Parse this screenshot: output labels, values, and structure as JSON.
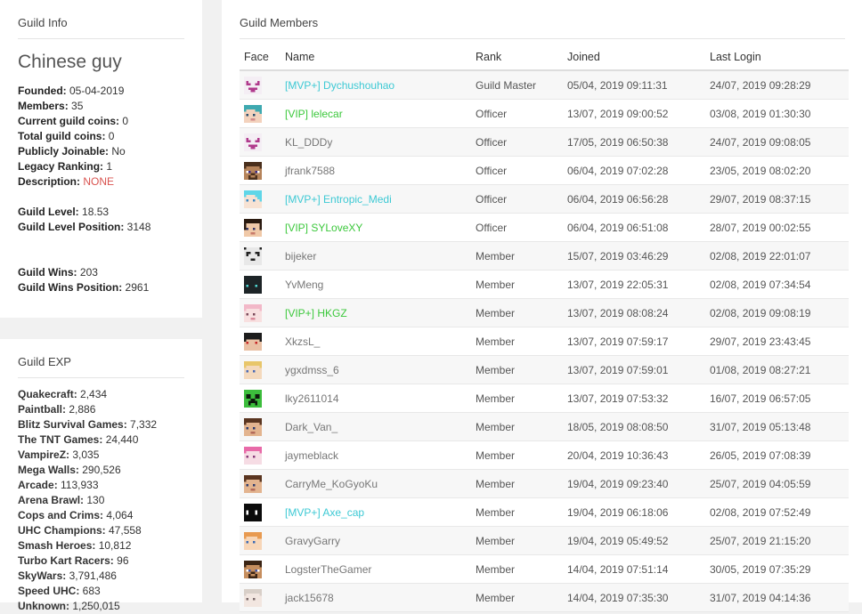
{
  "info": {
    "title": "Guild Info",
    "name": "Chinese guy",
    "stats": [
      {
        "label": "Founded:",
        "value": " 05-04-2019"
      },
      {
        "label": "Members:",
        "value": " 35"
      },
      {
        "label": "Current guild coins:",
        "value": " 0"
      },
      {
        "label": "Total guild coins:",
        "value": " 0"
      },
      {
        "label": "Publicly Joinable:",
        "value": " No"
      },
      {
        "label": "Legacy Ranking:",
        "value": " 1"
      },
      {
        "label": "Description:",
        "value": " NONE"
      }
    ],
    "level": {
      "label": "Guild Level:",
      "value": " 18.53"
    },
    "level_pos": {
      "label": "Guild Level Position:",
      "value": " 3148"
    },
    "wins": {
      "label": "Guild Wins:",
      "value": " 203"
    },
    "wins_pos": {
      "label": "Guild Wins Position:",
      "value": " 2961"
    },
    "none_color": "#d9534f"
  },
  "exp": {
    "title": "Guild EXP",
    "rows": [
      {
        "label": "Quakecraft:",
        "value": " 2,434"
      },
      {
        "label": "Paintball:",
        "value": " 2,886"
      },
      {
        "label": "Blitz Survival Games:",
        "value": " 7,332"
      },
      {
        "label": "The TNT Games:",
        "value": " 24,440"
      },
      {
        "label": "VampireZ:",
        "value": " 3,035"
      },
      {
        "label": "Mega Walls:",
        "value": " 290,526"
      },
      {
        "label": "Arcade:",
        "value": " 113,933"
      },
      {
        "label": "Arena Brawl:",
        "value": " 130"
      },
      {
        "label": "Cops and Crims:",
        "value": " 4,064"
      },
      {
        "label": "UHC Champions:",
        "value": " 47,558"
      },
      {
        "label": "Smash Heroes:",
        "value": " 10,812"
      },
      {
        "label": "Turbo Kart Racers:",
        "value": " 96"
      },
      {
        "label": "SkyWars:",
        "value": " 3,791,486"
      },
      {
        "label": "Speed UHC:",
        "value": " 683"
      },
      {
        "label": "Unknown:",
        "value": " 1,250,015"
      }
    ]
  },
  "members": {
    "title": "Guild Members",
    "columns": [
      "Face",
      "Name",
      "Rank",
      "Joined",
      "Last Login"
    ],
    "colors": {
      "mvp": "#3dc9d4",
      "vip": "#3cc83c",
      "plain": "#777777"
    },
    "rows": [
      {
        "face": "pink-skull-skin",
        "rank_tag": "[MVP+]",
        "name": "Dychushouhao",
        "style": "mvp",
        "rank": "Guild Master",
        "joined": "05/04, 2019 09:11:31",
        "last": "24/07, 2019 09:28:29"
      },
      {
        "face": "teal-hair-skin",
        "rank_tag": "[VIP]",
        "name": "lelecar",
        "style": "vip",
        "rank": "Officer",
        "joined": "13/07, 2019 09:00:52",
        "last": "03/08, 2019 01:30:30"
      },
      {
        "face": "pink-skull-skin",
        "rank_tag": "",
        "name": "KL_DDDy",
        "style": "plain",
        "rank": "Officer",
        "joined": "17/05, 2019 06:50:38",
        "last": "24/07, 2019 09:08:05"
      },
      {
        "face": "brown-skin",
        "rank_tag": "",
        "name": "jfrank7588",
        "style": "plain",
        "rank": "Officer",
        "joined": "06/04, 2019 07:02:28",
        "last": "23/05, 2019 08:02:20"
      },
      {
        "face": "cyan-hair-skin",
        "rank_tag": "[MVP+]",
        "name": "Entropic_Medi",
        "style": "mvp",
        "rank": "Officer",
        "joined": "06/04, 2019 06:56:28",
        "last": "29/07, 2019 08:37:15"
      },
      {
        "face": "dark-hair-skin",
        "rank_tag": "[VIP]",
        "name": "SYLoveXY",
        "style": "vip",
        "rank": "Officer",
        "joined": "06/04, 2019 06:51:08",
        "last": "28/07, 2019 00:02:55"
      },
      {
        "face": "panda-skin",
        "rank_tag": "",
        "name": "bijeker",
        "style": "plain",
        "rank": "Member",
        "joined": "15/07, 2019 03:46:29",
        "last": "02/08, 2019 22:01:07"
      },
      {
        "face": "black-mask-skin",
        "rank_tag": "",
        "name": "YvMeng",
        "style": "plain",
        "rank": "Member",
        "joined": "13/07, 2019 22:05:31",
        "last": "02/08, 2019 07:34:54"
      },
      {
        "face": "light-pink-skin",
        "rank_tag": "[VIP+]",
        "name": "HKGZ",
        "style": "vip",
        "rank": "Member",
        "joined": "13/07, 2019 08:08:24",
        "last": "02/08, 2019 09:08:19"
      },
      {
        "face": "red-eyes-skin",
        "rank_tag": "",
        "name": "XkzsL_",
        "style": "plain",
        "rank": "Member",
        "joined": "13/07, 2019 07:59:17",
        "last": "29/07, 2019 23:43:45"
      },
      {
        "face": "blonde-skin",
        "rank_tag": "",
        "name": "ygxdmss_6",
        "style": "plain",
        "rank": "Member",
        "joined": "13/07, 2019 07:59:01",
        "last": "01/08, 2019 08:27:21"
      },
      {
        "face": "creeper-skin",
        "rank_tag": "",
        "name": "lky2611014",
        "style": "plain",
        "rank": "Member",
        "joined": "13/07, 2019 07:53:32",
        "last": "16/07, 2019 06:57:05"
      },
      {
        "face": "brown-hair-skin",
        "rank_tag": "",
        "name": "Dark_Van_",
        "style": "plain",
        "rank": "Member",
        "joined": "18/05, 2019 08:08:50",
        "last": "31/07, 2019 05:13:48"
      },
      {
        "face": "pink-hair-skin",
        "rank_tag": "",
        "name": "jaymeblack",
        "style": "plain",
        "rank": "Member",
        "joined": "20/04, 2019 10:36:43",
        "last": "26/05, 2019 07:08:39"
      },
      {
        "face": "brown-hair-skin",
        "rank_tag": "",
        "name": "CarryMe_KoGyoKu",
        "style": "plain",
        "rank": "Member",
        "joined": "19/04, 2019 09:23:40",
        "last": "25/07, 2019 04:05:59"
      },
      {
        "face": "black-face-skin",
        "rank_tag": "[MVP+]",
        "name": "Axe_cap",
        "style": "mvp",
        "rank": "Member",
        "joined": "19/04, 2019 06:18:06",
        "last": "02/08, 2019 07:52:49"
      },
      {
        "face": "orange-hair-skin",
        "rank_tag": "",
        "name": "GravyGarry",
        "style": "plain",
        "rank": "Member",
        "joined": "19/04, 2019 05:49:52",
        "last": "25/07, 2019 21:15:20"
      },
      {
        "face": "steve-skin",
        "rank_tag": "",
        "name": "LogsterTheGamer",
        "style": "plain",
        "rank": "Member",
        "joined": "14/04, 2019 07:51:14",
        "last": "30/05, 2019 07:35:29"
      },
      {
        "face": "pale-skin",
        "rank_tag": "",
        "name": "jack15678",
        "style": "plain",
        "rank": "Member",
        "joined": "14/04, 2019 07:35:30",
        "last": "31/07, 2019 04:14:36"
      }
    ]
  }
}
